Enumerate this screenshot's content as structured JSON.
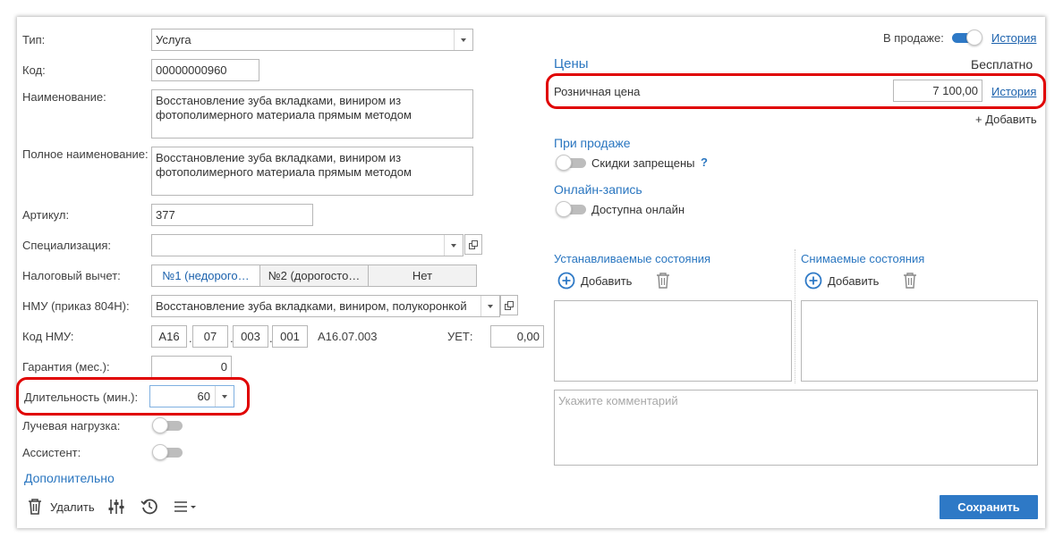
{
  "left": {
    "type": {
      "label": "Тип:",
      "value": "Услуга"
    },
    "code": {
      "label": "Код:",
      "value": "00000000960"
    },
    "name": {
      "label": "Наименование:",
      "line1": "Восстановление зуба вкладками, виниром из",
      "line2": "фотополимерного материала прямым методом"
    },
    "full_name": {
      "label": "Полное наименование:",
      "line1": "Восстановление зуба вкладками, виниром из",
      "line2": "фотополимерного материала прямым методом"
    },
    "article": {
      "label": "Артикул:",
      "value": "377"
    },
    "specialization": {
      "label": "Специализация:",
      "value": ""
    },
    "tax": {
      "label": "Налоговый вычет:",
      "options": [
        "№1 (недорого…",
        "№2 (дорогосто…",
        "Нет"
      ],
      "selected": 0
    },
    "nmu": {
      "label": "НМУ (приказ 804Н):",
      "value": "Восстановление зуба вкладками, виниром, полукоронкой"
    },
    "nmu_code": {
      "label": "Код НМУ:",
      "parts": [
        "А16",
        "07",
        "003",
        "001"
      ],
      "full": "А16.07.003",
      "uet_label": "УЕТ:",
      "uet_value": "0,00"
    },
    "warranty": {
      "label": "Гарантия (мес.):",
      "value": "0"
    },
    "duration": {
      "label": "Длительность (мин.):",
      "value": "60"
    },
    "radiation": {
      "label": "Лучевая нагрузка:",
      "on": false
    },
    "assistant": {
      "label": "Ассистент:",
      "on": false
    },
    "more_link": "Дополнительно"
  },
  "right": {
    "on_sale": {
      "label": "В продаже:",
      "on": true,
      "history": "История"
    },
    "prices": {
      "title": "Цены",
      "free": "Бесплатно",
      "retail_label": "Розничная цена",
      "retail_value": "7 100,00",
      "history": "История",
      "add": "+ Добавить"
    },
    "on_selling": {
      "title": "При продаже",
      "discounts_label": "Скидки запрещены",
      "help": "?",
      "on": false
    },
    "online": {
      "title": "Онлайн-запись",
      "available_label": "Доступна онлайн",
      "on": false
    },
    "set_states": {
      "title": "Устанавливаемые состояния",
      "add": "Добавить"
    },
    "removed_states": {
      "title": "Снимаемые состояния",
      "add": "Добавить"
    },
    "comment_placeholder": "Укажите комментарий"
  },
  "toolbar": {
    "delete": "Удалить",
    "save": "Сохранить"
  },
  "colors": {
    "accent": "#2e79c6",
    "highlight": "#e00000",
    "link": "#1c62ad"
  }
}
